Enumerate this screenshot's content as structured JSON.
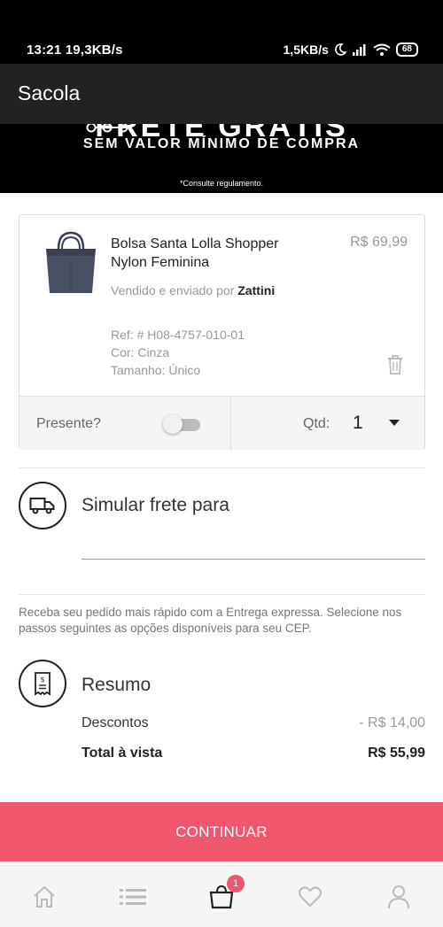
{
  "status_bar": {
    "time": "13:21",
    "speed_left": "19,3KB/s",
    "speed_right": "1,5KB/s",
    "battery": "68"
  },
  "app_bar": {
    "title": "Sacola"
  },
  "banner": {
    "title": "FRETE GRÁTIS",
    "subtitle": "SEM VALOR MÍNIMO DE COMPRA",
    "note": "*Consulte regulamento."
  },
  "product": {
    "name": "Bolsa Santa Lolla Shopper Nylon Feminina",
    "price": "R$ 69,99",
    "seller_prefix": "Vendido e enviado por",
    "seller_name": "Zattini",
    "ref": "Ref: # H08-4757-010-01",
    "color": "Cor: Cinza",
    "size": "Tamanho: Único",
    "gift_label": "Presente?",
    "gift_enabled": false,
    "qty_label": "Qtd:",
    "qty_value": "1"
  },
  "shipping": {
    "title": "Simular frete para",
    "cep_value": "",
    "info": "Receba seu pedido mais rápido com a Entrega expressa. Selecione nos passos seguintes as opções disponíveis para seu CEP."
  },
  "summary": {
    "title": "Resumo",
    "discount_label": "Descontos",
    "discount_value": "- R$ 14,00",
    "total_label": "Total à vista",
    "total_value": "R$ 55,99"
  },
  "actions": {
    "continue_label": "CONTINUAR"
  },
  "bottom_nav": {
    "items": [
      {
        "icon": "home-icon"
      },
      {
        "icon": "list-icon"
      },
      {
        "icon": "shopping-bag-icon"
      },
      {
        "icon": "heart-icon"
      },
      {
        "icon": "user-icon"
      }
    ],
    "cart_badge": "1"
  },
  "colors": {
    "accent": "#f0576c",
    "app_bar": "#222222",
    "muted_text": "#999999"
  }
}
